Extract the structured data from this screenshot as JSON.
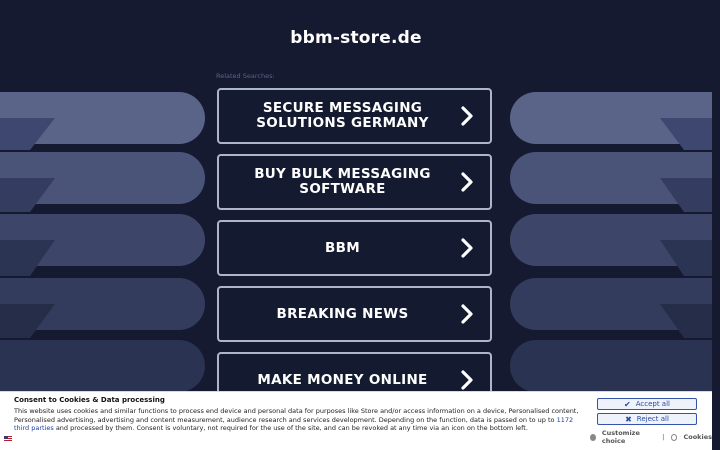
{
  "colors": {
    "background": "#151a30",
    "button_border": "#aeb5c8",
    "consent_accent": "#3553a8",
    "link_blue": "#1a3fa8"
  },
  "header": {
    "domain": "bbm-store.de"
  },
  "related": {
    "label": "Related Searches:"
  },
  "links": [
    {
      "label": "SECURE MESSAGING SOLUTIONS GERMANY"
    },
    {
      "label": "BUY BULK MESSAGING SOFTWARE"
    },
    {
      "label": "BBM"
    },
    {
      "label": "BREAKING NEWS"
    },
    {
      "label": "MAKE MONEY ONLINE"
    }
  ],
  "consent": {
    "title": "Consent to Cookies & Data processing",
    "text_before_link": "This website uses cookies and similar functions to process end device and personal data for purposes like Store and/or access information on a device, Personalised content, Personalised advertising, advertising and content measurement, audience research and services development. Depending on the function, data is passed on to up to ",
    "link_text": "1172 third parties",
    "text_after_link": " and processed by them. Consent is voluntary, not required for the use of the site, and can be revoked at any time via an icon on the bottom left.",
    "accept_label": "Accept all",
    "reject_label": "Reject all",
    "customize_label": "Customize choice",
    "separator": "|",
    "cookies_label": "Cookies",
    "icons": [
      "check-icon",
      "x-icon",
      "gear-icon",
      "cookie-icon",
      "flag-icon"
    ]
  }
}
